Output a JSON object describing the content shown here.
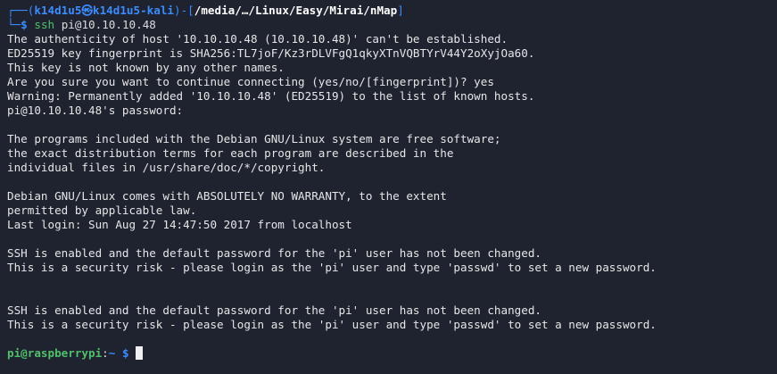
{
  "prompt": {
    "corner_top": "┌──(",
    "user_host": "k14d1u5㉿k14d1u5-kali",
    "close_paren": ")-[",
    "path": "/media/…/Linux/Easy/Mirai/nMap",
    "close_bracket": "]",
    "corner_bottom": "└─",
    "dollar": "$",
    "command_name": "ssh",
    "command_args": "pi@10.10.10.48"
  },
  "output_lines": [
    "The authenticity of host '10.10.10.48 (10.10.10.48)' can't be established.",
    "ED25519 key fingerprint is SHA256:TL7joF/Kz3rDLVFgQ1qkyXTnVQBTYrV44Y2oXyjOa60.",
    "This key is not known by any other names.",
    "Are you sure you want to continue connecting (yes/no/[fingerprint])? yes",
    "Warning: Permanently added '10.10.10.48' (ED25519) to the list of known hosts.",
    "pi@10.10.10.48's password:",
    "",
    "The programs included with the Debian GNU/Linux system are free software;",
    "the exact distribution terms for each program are described in the",
    "individual files in /usr/share/doc/*/copyright.",
    "",
    "Debian GNU/Linux comes with ABSOLUTELY NO WARRANTY, to the extent",
    "permitted by applicable law.",
    "Last login: Sun Aug 27 14:47:50 2017 from localhost",
    "",
    "SSH is enabled and the default password for the 'pi' user has not been changed.",
    "This is a security risk - please login as the 'pi' user and type 'passwd' to set a new password.",
    "",
    "",
    "SSH is enabled and the default password for the 'pi' user has not been changed.",
    "This is a security risk - please login as the 'pi' user and type 'passwd' to set a new password.",
    ""
  ],
  "remote_prompt": {
    "user_host": "pi@raspberrypi",
    "colon": ":",
    "path": "~",
    "dollar": "$"
  },
  "colors": {
    "background": "#1f2330",
    "prompt_frame": "#3a8dff",
    "command_green": "#4fc06a",
    "text": "#e6e6e6"
  }
}
